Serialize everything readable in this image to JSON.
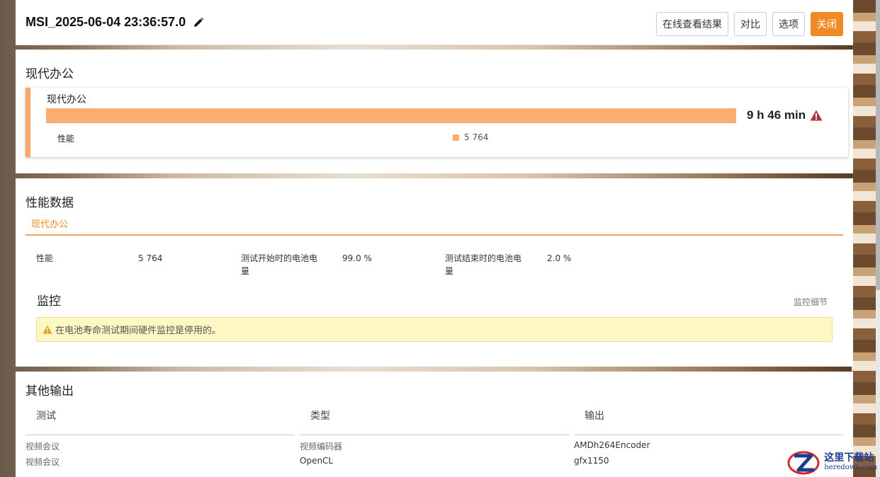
{
  "header": {
    "title": "MSI_2025-06-04 23:36:57.0",
    "buttons": {
      "view_online": "在线查看结果",
      "compare": "对比",
      "options": "选项",
      "close": "关闭"
    }
  },
  "summary": {
    "section_title": "现代办公",
    "benchmark_name": "现代办公",
    "duration": "9 h 46 min",
    "bar_fraction": 1.0,
    "perf_label": "性能",
    "legend_value": "5 764"
  },
  "performance": {
    "section_title": "性能数据",
    "tab": "现代办公",
    "items": [
      {
        "label": "性能",
        "value": "5 764"
      },
      {
        "label": "测试开始时的电池电量",
        "value": "99.0 %"
      },
      {
        "label": "测试结束时的电池电量",
        "value": "2.0 %"
      }
    ],
    "monitor_title": "监控",
    "monitor_link": "监控细节",
    "alert": "在电池寿命测试期间硬件监控是停用的。"
  },
  "other": {
    "section_title": "其他输出",
    "columns": [
      "测试",
      "类型",
      "输出"
    ],
    "rows": [
      [
        "视频会议",
        "视频编码器",
        "AMDh264Encoder"
      ],
      [
        "视频会议",
        "OpenCL",
        "gfx1150"
      ]
    ]
  },
  "watermark": {
    "cn": "这里下载站",
    "en": "heredown.com"
  },
  "colors": {
    "accent": "#f08a24",
    "bar": "#f8ad73",
    "alert_bg": "#fdf7c3"
  }
}
